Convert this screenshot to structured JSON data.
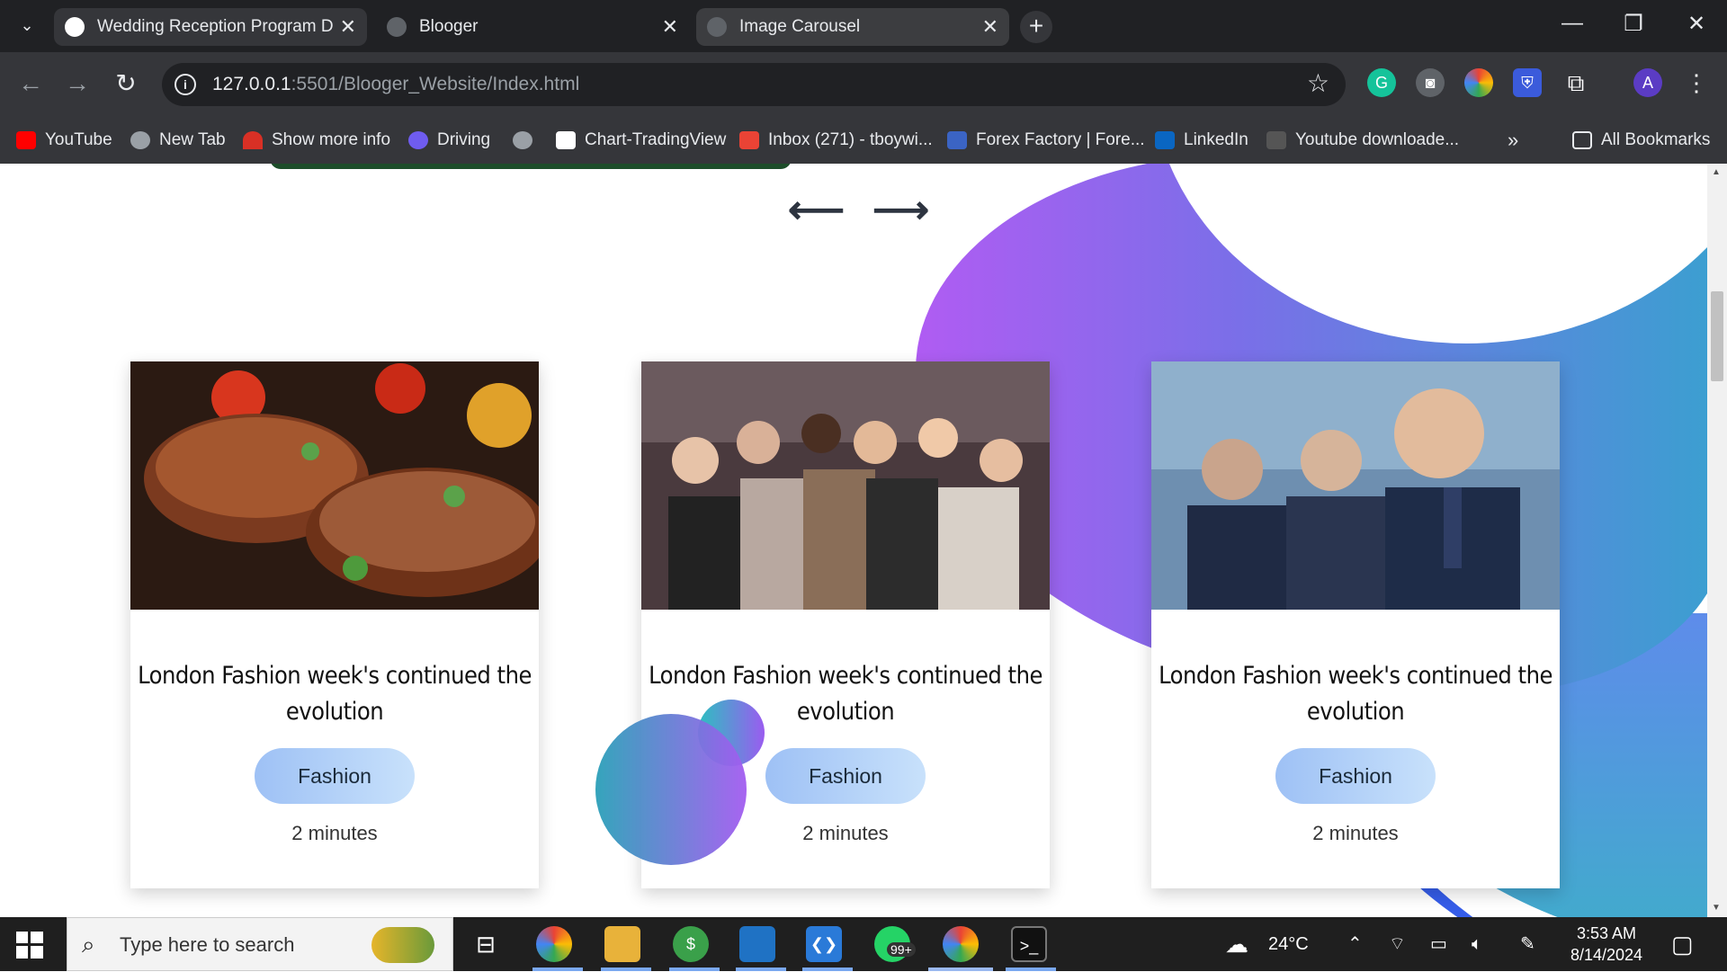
{
  "tabs": [
    {
      "title": "Wedding Reception Program D",
      "close": "✕"
    },
    {
      "title": "Blooger",
      "close": "✕"
    },
    {
      "title": "Image Carousel",
      "close": "✕"
    }
  ],
  "new_tab": "+",
  "omnibox": {
    "host": "127.0.0.1",
    "path": ":5501/Blooger_Website/Index.html"
  },
  "bookmarks": [
    {
      "label": "YouTube",
      "color": "#ff0000"
    },
    {
      "label": "New Tab",
      "color": "#9aa0a6"
    },
    {
      "label": "Show more info",
      "color": "#d93025"
    },
    {
      "label": "Driving",
      "color": "#6f5cf0"
    },
    {
      "label": "",
      "color": "#9aa0a6"
    },
    {
      "label": "Chart-TradingView",
      "color": "#ffffff"
    },
    {
      "label": "Inbox (271) - tboywi...",
      "color": "#ea4335"
    },
    {
      "label": "Forex Factory | Fore...",
      "color": "#3b64c4"
    },
    {
      "label": "LinkedIn",
      "color": "#0a66c2"
    },
    {
      "label": "Youtube downloade...",
      "color": "#555555"
    }
  ],
  "all_bookmarks": "All Bookmarks",
  "carousel": {
    "prev": "⟵",
    "next": "⟶"
  },
  "cards": [
    {
      "title": "London Fashion week's continued the evolution",
      "tag": "Fashion",
      "time": "2 minutes"
    },
    {
      "title": "London Fashion week's continued the evolution",
      "tag": "Fashion",
      "time": "2 minutes"
    },
    {
      "title": "London Fashion week's continued the evolution",
      "tag": "Fashion",
      "time": "2 minutes"
    }
  ],
  "taskbar": {
    "search_placeholder": "Type here to search",
    "weather": "24°C",
    "time": "3:53 AM",
    "date": "8/14/2024",
    "whatsapp_badge": "99+"
  },
  "profile_initial": "A"
}
